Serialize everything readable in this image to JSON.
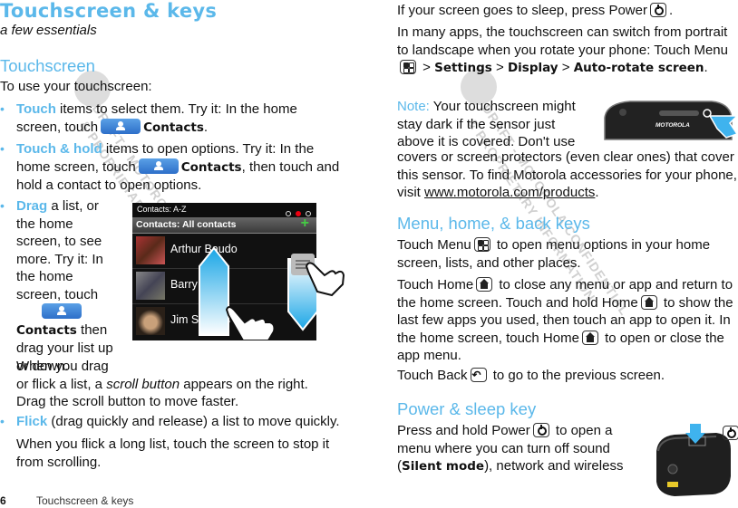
{
  "page": {
    "title": "Touchscreen & keys",
    "subtitle": "a few essentials",
    "footer": {
      "page_number": "6",
      "section": "Touchscreen & keys"
    },
    "accent_color": "#5bb8ea"
  },
  "left": {
    "heading": "Touchscreen",
    "intro": "To use your touchscreen:",
    "bullets": [
      {
        "term": "Touch",
        "text_before": " items to select them. Try it: In the home screen, touch",
        "icon": "contacts-app-icon",
        "label": "Contacts",
        "text_after": "."
      },
      {
        "term": "Touch & hold",
        "text_before": " items to open options. Try it: In the home screen, touch",
        "icon": "contacts-app-icon",
        "label": "Contacts",
        "text_after": ", then touch and hold a contact to open options."
      },
      {
        "term": "Drag",
        "text_before": " a list, or the home screen, to see more. Try it: In the home screen, touch",
        "icon": "contacts-app-icon",
        "label": "Contacts",
        "text_after": " then drag your list up or down."
      },
      {
        "term": "Flick",
        "text_after": " (drag quickly and release) a list to move quickly."
      }
    ],
    "drag_note_1": "When you drag",
    "drag_note_2a": "or flick a list, a ",
    "drag_note_em": "scroll button",
    "drag_note_2b": " appears on the right.",
    "drag_note_3": "Drag the scroll button to move faster.",
    "flick_note": "When you flick a long list, touch the screen to stop it from scrolling."
  },
  "contacts_screen": {
    "top_label": "Contacts: A-Z",
    "list_title": "Contacts: All contacts",
    "add_icon": "plus-icon",
    "contacts": [
      {
        "name": "Arthur Baudo"
      },
      {
        "name": "Barry"
      },
      {
        "name": "Jim Somers"
      }
    ]
  },
  "right": {
    "sleep_text_a": "If your screen goes to sleep, press Power",
    "sleep_text_b": ".",
    "rotate_a": "In many apps, the touchscreen can switch from portrait to landscape when you rotate your phone: Touch Menu",
    "rotate_path": [
      "Settings",
      "Display",
      "Auto-rotate screen"
    ],
    "note_label": "Note:",
    "note_text_a": " Your touchscreen might stay dark if the sensor just above it is covered. Don't use",
    "note_text_b": "covers or screen protectors (even clear ones) that cover this sensor. To find Motorola accessories for your phone, visit ",
    "note_link": "www.motorola.com/products",
    "note_end": ".",
    "phone_brand": "MOTOROLA",
    "keys_heading": "Menu, home, & back keys",
    "menu_a": "Touch Menu",
    "menu_b": " to open menu options in your home screen, lists, and other places.",
    "home_a": "Touch Home",
    "home_b": " to close any menu or app and return to the home screen. Touch and hold Home",
    "home_c": " to show the last few apps you used, then touch an app to open it. In the home screen, touch Home",
    "home_d": " to open or close the app menu.",
    "back_a": "Touch Back",
    "back_b": " to go to the previous screen.",
    "power_heading": "Power & sleep key",
    "power_a": "Press and hold Power",
    "power_b": " to open a menu where you can turn off sound (",
    "power_bold": "Silent mode",
    "power_c": "), network and wireless"
  },
  "watermark": {
    "line1": "DRAFT - MOTOROLA CONFIDENTIAL",
    "line2": "& PROPRIETARY INFORMATION"
  }
}
